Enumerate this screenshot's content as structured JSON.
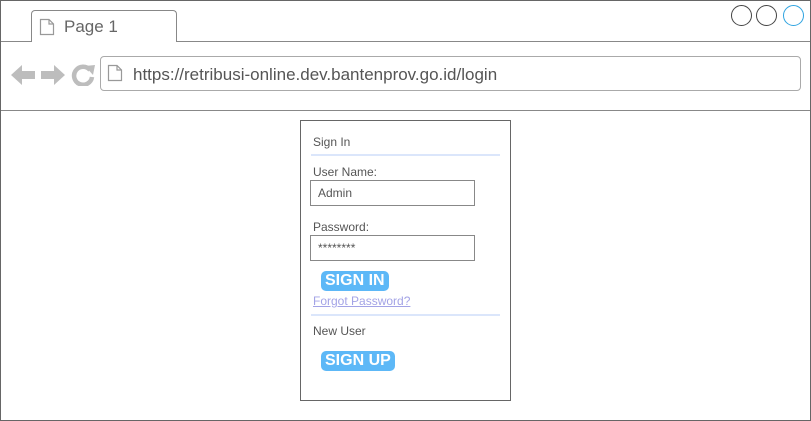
{
  "browser": {
    "tab_label": "Page 1",
    "url": "https://retribusi-online.dev.bantenprov.go.id/login"
  },
  "signin": {
    "title": "Sign In",
    "username_label": "User Name:",
    "username_value": "Admin",
    "password_label": "Password:",
    "password_value": "********",
    "signin_button": "SIGN IN",
    "forgot_link": "Forgot Password?"
  },
  "newuser": {
    "title": "New User",
    "signup_button": "SIGN UP"
  },
  "colors": {
    "button": "#5db8f7",
    "separator": "#dbe6fb",
    "link": "#a3a3e6",
    "maximize_ring": "#2ea3e0"
  },
  "icons": [
    "document-icon",
    "back-arrow-icon",
    "forward-arrow-icon",
    "reload-icon",
    "minimize-circle-icon",
    "restore-circle-icon",
    "maximize-circle-icon"
  ]
}
